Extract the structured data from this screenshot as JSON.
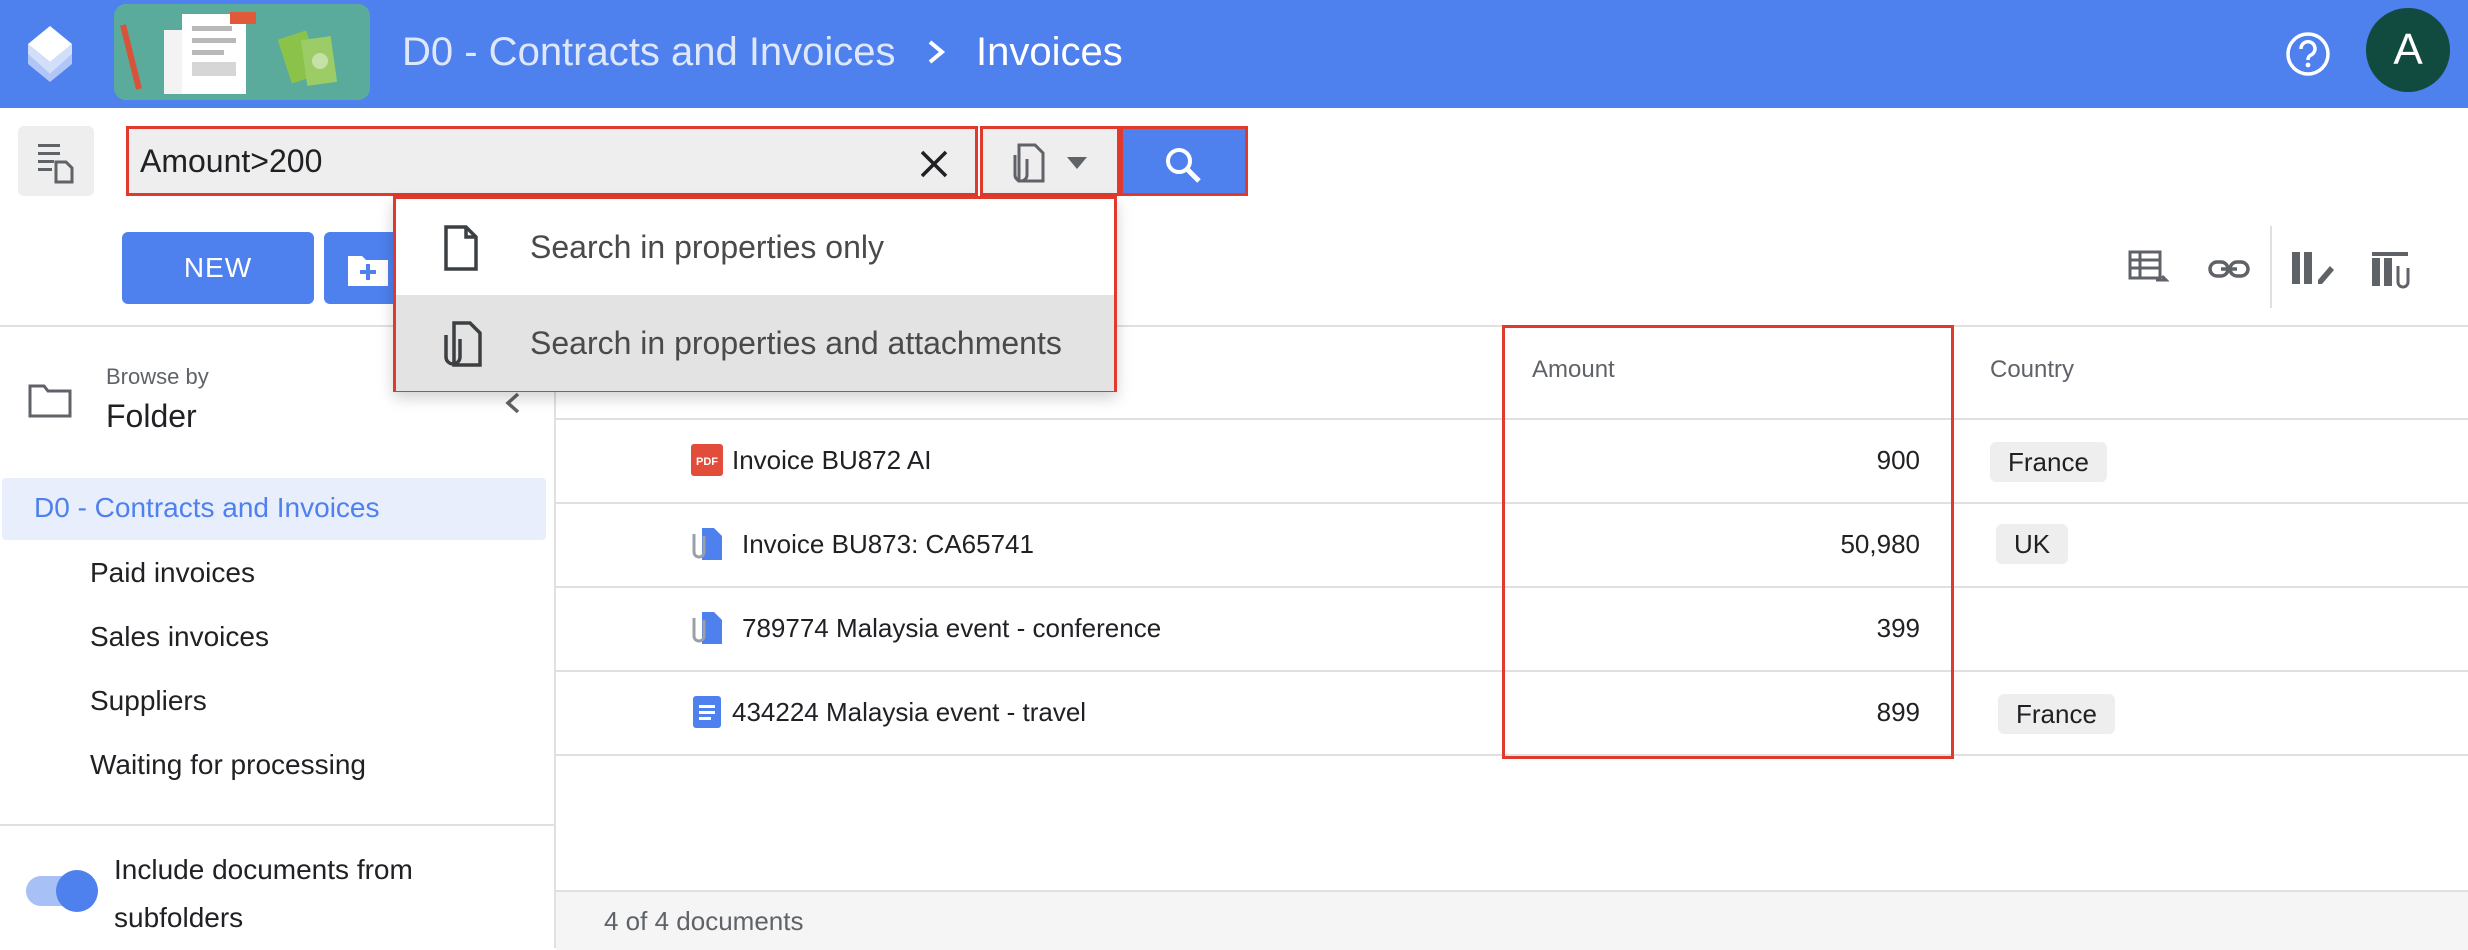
{
  "header": {
    "breadcrumb_parent": "D0 - Contracts and Invoices",
    "breadcrumb_current": "Invoices",
    "avatar_letter": "A",
    "accent": "#4e80ee"
  },
  "search": {
    "query": "Amount>200"
  },
  "search_mode_menu": {
    "items": [
      {
        "label": "Search in properties only",
        "icon": "file-icon"
      },
      {
        "label": "Search in properties and attachments",
        "icon": "file-attachment-icon"
      }
    ]
  },
  "toolbar": {
    "new_label": "NEW"
  },
  "sidebar": {
    "browse_by_label": "Browse by",
    "browse_by_value": "Folder",
    "root": "D0 - Contracts and Invoices",
    "children": [
      "Paid invoices",
      "Sales invoices",
      "Suppliers",
      "Waiting for processing"
    ],
    "include_subfolders_label": "Include documents from subfolders",
    "include_subfolders_on": true
  },
  "table": {
    "columns": [
      "Amount",
      "Country"
    ],
    "rows": [
      {
        "title": "Invoice BU872 AI",
        "icon": "pdf-icon",
        "amount": "900",
        "country": "France"
      },
      {
        "title": "Invoice BU873: CA65741",
        "icon": "file-attachment-icon",
        "amount": "50,980",
        "country": "UK"
      },
      {
        "title": "789774 Malaysia event - conference",
        "icon": "file-attachment-icon",
        "amount": "399",
        "country": ""
      },
      {
        "title": "434224 Malaysia event - travel",
        "icon": "google-doc-icon",
        "amount": "899",
        "country": "France"
      }
    ]
  },
  "footer": {
    "count_text": "4 of 4 documents"
  }
}
